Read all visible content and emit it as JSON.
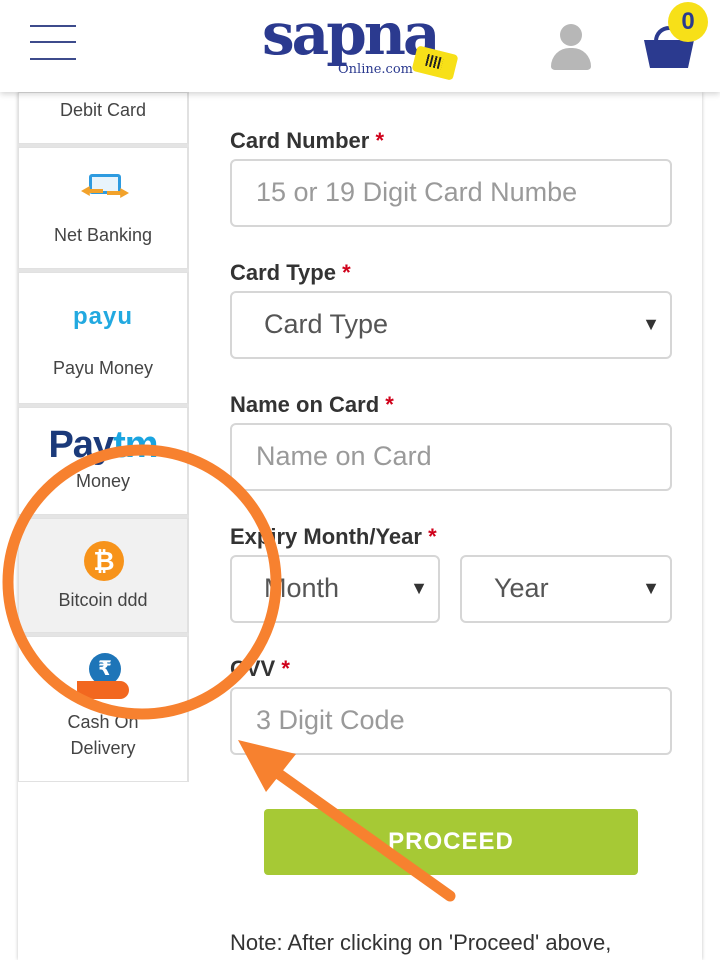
{
  "header": {
    "logo_main": "sapna",
    "logo_sub": "Online.com",
    "cart_count": "0"
  },
  "payment_tabs": [
    {
      "label": "Debit Card",
      "icon": "debit-card-icon"
    },
    {
      "label": "Net Banking",
      "icon": "net-banking-icon"
    },
    {
      "label": "Payu Money",
      "icon": "payu-logo",
      "logo_text": "payu"
    },
    {
      "label": "Money",
      "icon": "paytm-logo",
      "logo_text": "Paytm"
    },
    {
      "label": "Bitcoin ddd",
      "icon": "bitcoin-icon",
      "glyph": "₿"
    },
    {
      "label_line1": "Cash On",
      "label_line2": "Delivery",
      "icon": "cash-on-delivery-icon",
      "glyph": "₹"
    }
  ],
  "form": {
    "card_number": {
      "label": "Card Number",
      "required": "*",
      "placeholder": "15 or 19 Digit Card Numbe"
    },
    "card_type": {
      "label": "Card Type",
      "required": "*",
      "selected": "Card Type"
    },
    "name_on_card": {
      "label": "Name on Card",
      "required": "*",
      "placeholder": "Name on Card"
    },
    "expiry": {
      "label": "Expiry Month/Year",
      "required": "*",
      "month_selected": "Month",
      "year_selected": "Year"
    },
    "cvv": {
      "label": "CVV",
      "required": "*",
      "placeholder": "3 Digit Code"
    },
    "proceed_label": "PROCEED",
    "note": "Note: After clicking on 'Proceed' above,"
  },
  "colors": {
    "brand_blue": "#2b3a8f",
    "accent_yellow": "#f7e018",
    "proceed_green": "#a6c935",
    "required_red": "#d0021b",
    "annotation_orange": "#f7812f"
  }
}
